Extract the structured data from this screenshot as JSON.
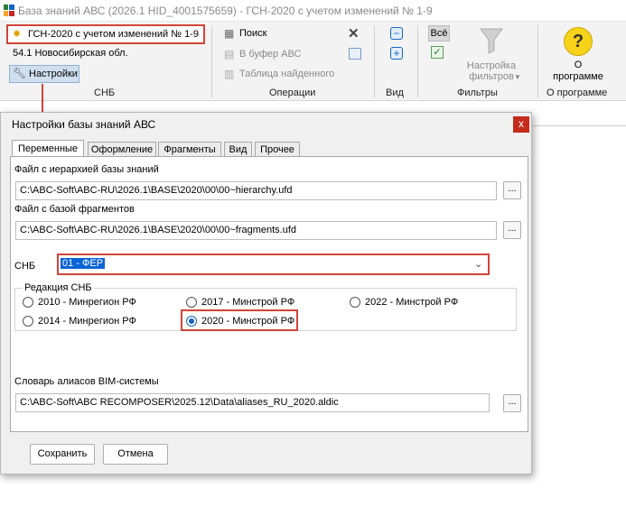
{
  "window": {
    "title": "База знаний АВС (2026.1 HID_4001575659) - ГСН-2020 с учетом изменений № 1-9"
  },
  "ribbon": {
    "snb": {
      "selected": "ГСН-2020 с учетом изменений № 1-9",
      "region": "54.1 Новосибирская обл.",
      "settings": "Настройки",
      "group_label": "СНБ"
    },
    "operations": {
      "search": "Поиск",
      "to_buffer": "В буфер АВС",
      "found_table": "Таблица найденного",
      "group_label": "Операции"
    },
    "view": {
      "group_label": "Вид"
    },
    "filters": {
      "all_label": "Всё",
      "filter_settings": "Настройка фильтров",
      "group_label": "Фильтры"
    },
    "about": {
      "label": "О программе",
      "group_label": "О программе"
    }
  },
  "dialog": {
    "title": "Настройки базы знаний АВС",
    "close": "x",
    "tabs": [
      "Переменные",
      "Оформление",
      "Фрагменты",
      "Вид",
      "Прочее"
    ],
    "hierarchy_label": "Файл с иерархией базы знаний",
    "hierarchy_value": "C:\\ABC-Soft\\ABC-RU\\2026.1\\BASE\\2020\\00\\00~hierarchy.ufd",
    "fragments_label": "Файл с базой фрагментов",
    "fragments_value": "C:\\ABC-Soft\\ABC-RU\\2026.1\\BASE\\2020\\00\\00~fragments.ufd",
    "browse": "...",
    "snb_label": "СНБ",
    "snb_value": "01 - ФЕР",
    "edition_label": "Редакция СНБ",
    "editions": {
      "r2010": "2010 - Минрегион РФ",
      "r2017": "2017 - Минстрой РФ",
      "r2022": "2022 - Минстрой РФ",
      "r2014": "2014 - Минрегион РФ",
      "r2020": "2020 - Минстрой РФ"
    },
    "selected_edition": "2020 - Минстрой РФ",
    "bim_label": "Словарь алиасов BIM-системы",
    "bim_value": "C:\\ABC-Soft\\ABC RECOMPOSER\\2025.12\\Data\\aliases_RU_2020.aldic",
    "save": "Сохранить",
    "cancel": "Отмена"
  },
  "colors": {
    "accent": "#1565c0",
    "highlight": "#d2443a",
    "selection": "#0a64d6"
  }
}
